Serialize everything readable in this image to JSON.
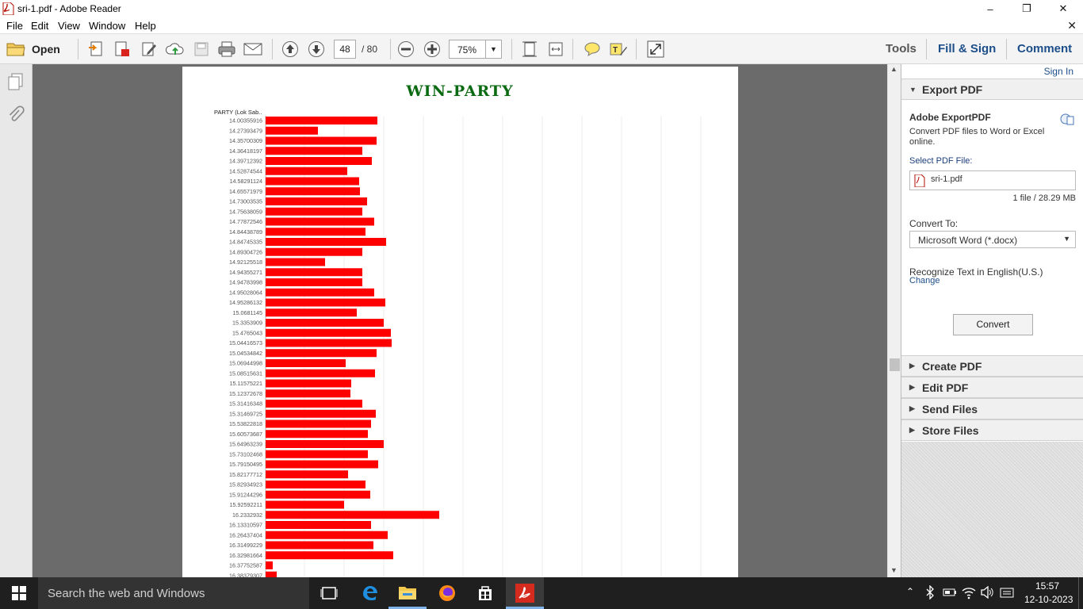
{
  "window": {
    "title": "sri-1.pdf - Adobe Reader"
  },
  "menu": [
    "File",
    "Edit",
    "View",
    "Window",
    "Help"
  ],
  "toolbar": {
    "open_label": "Open",
    "page_current": "48",
    "page_total": "/ 80",
    "zoom": "75%",
    "tools_label": "Tools",
    "fill_sign_label": "Fill & Sign",
    "comment_label": "Comment"
  },
  "document": {
    "chart_data": {
      "type": "bar",
      "orientation": "horizontal",
      "title": "WIN-PARTY",
      "category_header": "PARTY (Lok Sab..",
      "categories": [
        "14.00355916",
        "14.27393479",
        "14.35700309",
        "14.36418197",
        "14.39712392",
        "14.52874544",
        "14.58291124",
        "14.65571979",
        "14.73003535",
        "14.75638059",
        "14.77872546",
        "14.84438789",
        "14.84745335",
        "14.89304726",
        "14.92125518",
        "14.94355271",
        "14.94783998",
        "14.95028064",
        "14.95286132",
        "15.0681145",
        "15.3353909",
        "15.4765043",
        "15.04416573",
        "15.04534842",
        "15.06944998",
        "15.08515631",
        "15.11575221",
        "15.12372678",
        "15.31416348",
        "15.31469725",
        "15.53822818",
        "15.60573687",
        "15.64963239",
        "15.73102468",
        "15.79150495",
        "15.82177712",
        "15.82934923",
        "15.91244296",
        "15.92592211",
        "16.2332932",
        "16.13310597",
        "16.26437404",
        "16.31499229",
        "16.32981664",
        "16.37752587",
        "16.38379307"
      ],
      "values": [
        141,
        66,
        140,
        122,
        134,
        103,
        118,
        119,
        128,
        122,
        137,
        126,
        152,
        122,
        75,
        122,
        122,
        137,
        151,
        115,
        149,
        158,
        159,
        140,
        101,
        138,
        108,
        107,
        122,
        139,
        133,
        129,
        149,
        129,
        142,
        104,
        126,
        132,
        99,
        219,
        133,
        154,
        136,
        161,
        9,
        14
      ],
      "bar_color": "#ff0000",
      "grid": true
    }
  },
  "right_panel": {
    "sign_in": "Sign In",
    "export_title": "Export PDF",
    "adobe_export_title": "Adobe ExportPDF",
    "adobe_export_desc": "Convert PDF files to Word or Excel online.",
    "select_label": "Select PDF File:",
    "file_name": "sri-1.pdf",
    "file_info": "1 file / 28.29 MB",
    "convert_to_label": "Convert To:",
    "convert_to_value": "Microsoft Word (*.docx)",
    "recognize_text": "Recognize Text in English(U.S.)",
    "change_link": "Change",
    "convert_button": "Convert",
    "sections": [
      "Create PDF",
      "Edit PDF",
      "Send Files",
      "Store Files"
    ]
  },
  "taskbar": {
    "search_placeholder": "Search the web and Windows",
    "time": "15:57",
    "date": "12-10-2023"
  },
  "colors": {
    "title_green": "#0a6a12",
    "link_blue": "#1a4fa0",
    "accent": "#1c4e8a"
  }
}
